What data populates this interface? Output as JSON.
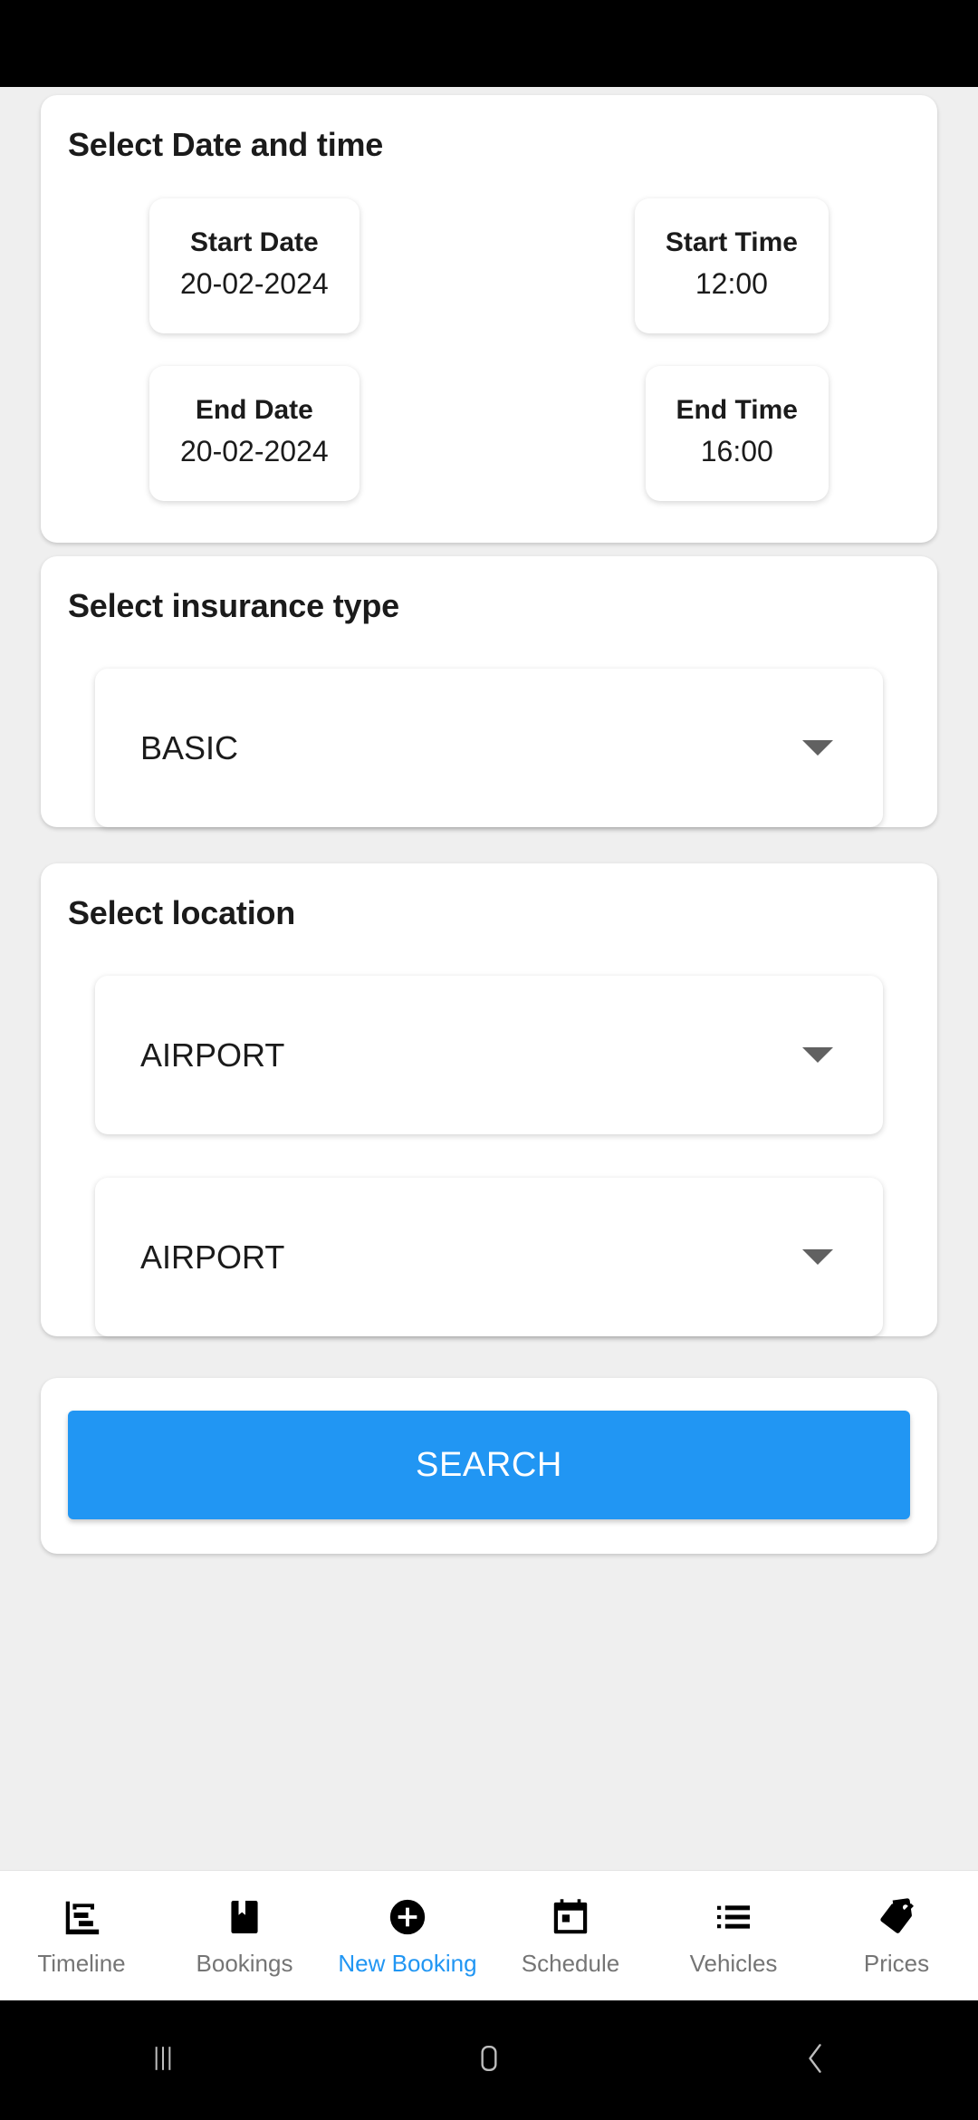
{
  "screen": {
    "background_color": "#EFEFEF",
    "accent_color": "#2196F3"
  },
  "datetime_section": {
    "title": "Select Date and time",
    "fields": [
      {
        "label": "Start Date",
        "value": "20-02-2024",
        "icon": "calendar-icon"
      },
      {
        "label": "Start Time",
        "value": "12:00",
        "icon": "clock-icon"
      },
      {
        "label": "End Date",
        "value": "20-02-2024",
        "icon": "calendar-icon"
      },
      {
        "label": "End Time",
        "value": "16:00",
        "icon": "clock-icon"
      }
    ]
  },
  "insurance_section": {
    "title": "Select insurance type",
    "dropdown": {
      "selected": "BASIC",
      "caret_icon": "chevron-down-icon"
    }
  },
  "location_section": {
    "title": "Select location",
    "pickup_dropdown": {
      "selected": "AIRPORT",
      "caret_icon": "chevron-down-icon"
    },
    "dropoff_dropdown": {
      "selected": "AIRPORT",
      "caret_icon": "chevron-down-icon"
    }
  },
  "search_section": {
    "button_label": "SEARCH",
    "button_color": "#2196F3"
  },
  "tabbar": {
    "active_index": 2,
    "active_color": "#2196F3",
    "inactive_color": "#757575",
    "items": [
      {
        "label": "Timeline",
        "icon": "timeline-chart-icon"
      },
      {
        "label": "Bookings",
        "icon": "bookmark-icon"
      },
      {
        "label": "New Booking",
        "icon": "plus-circle-icon"
      },
      {
        "label": "Schedule",
        "icon": "calendar-icon"
      },
      {
        "label": "Vehicles",
        "icon": "list-icon"
      },
      {
        "label": "Prices",
        "icon": "price-tag-icon"
      }
    ]
  },
  "android_nav": {
    "items": [
      {
        "name": "recents",
        "icon": "recents-icon"
      },
      {
        "name": "home",
        "icon": "home-icon"
      },
      {
        "name": "back",
        "icon": "back-chevron-icon"
      }
    ]
  }
}
